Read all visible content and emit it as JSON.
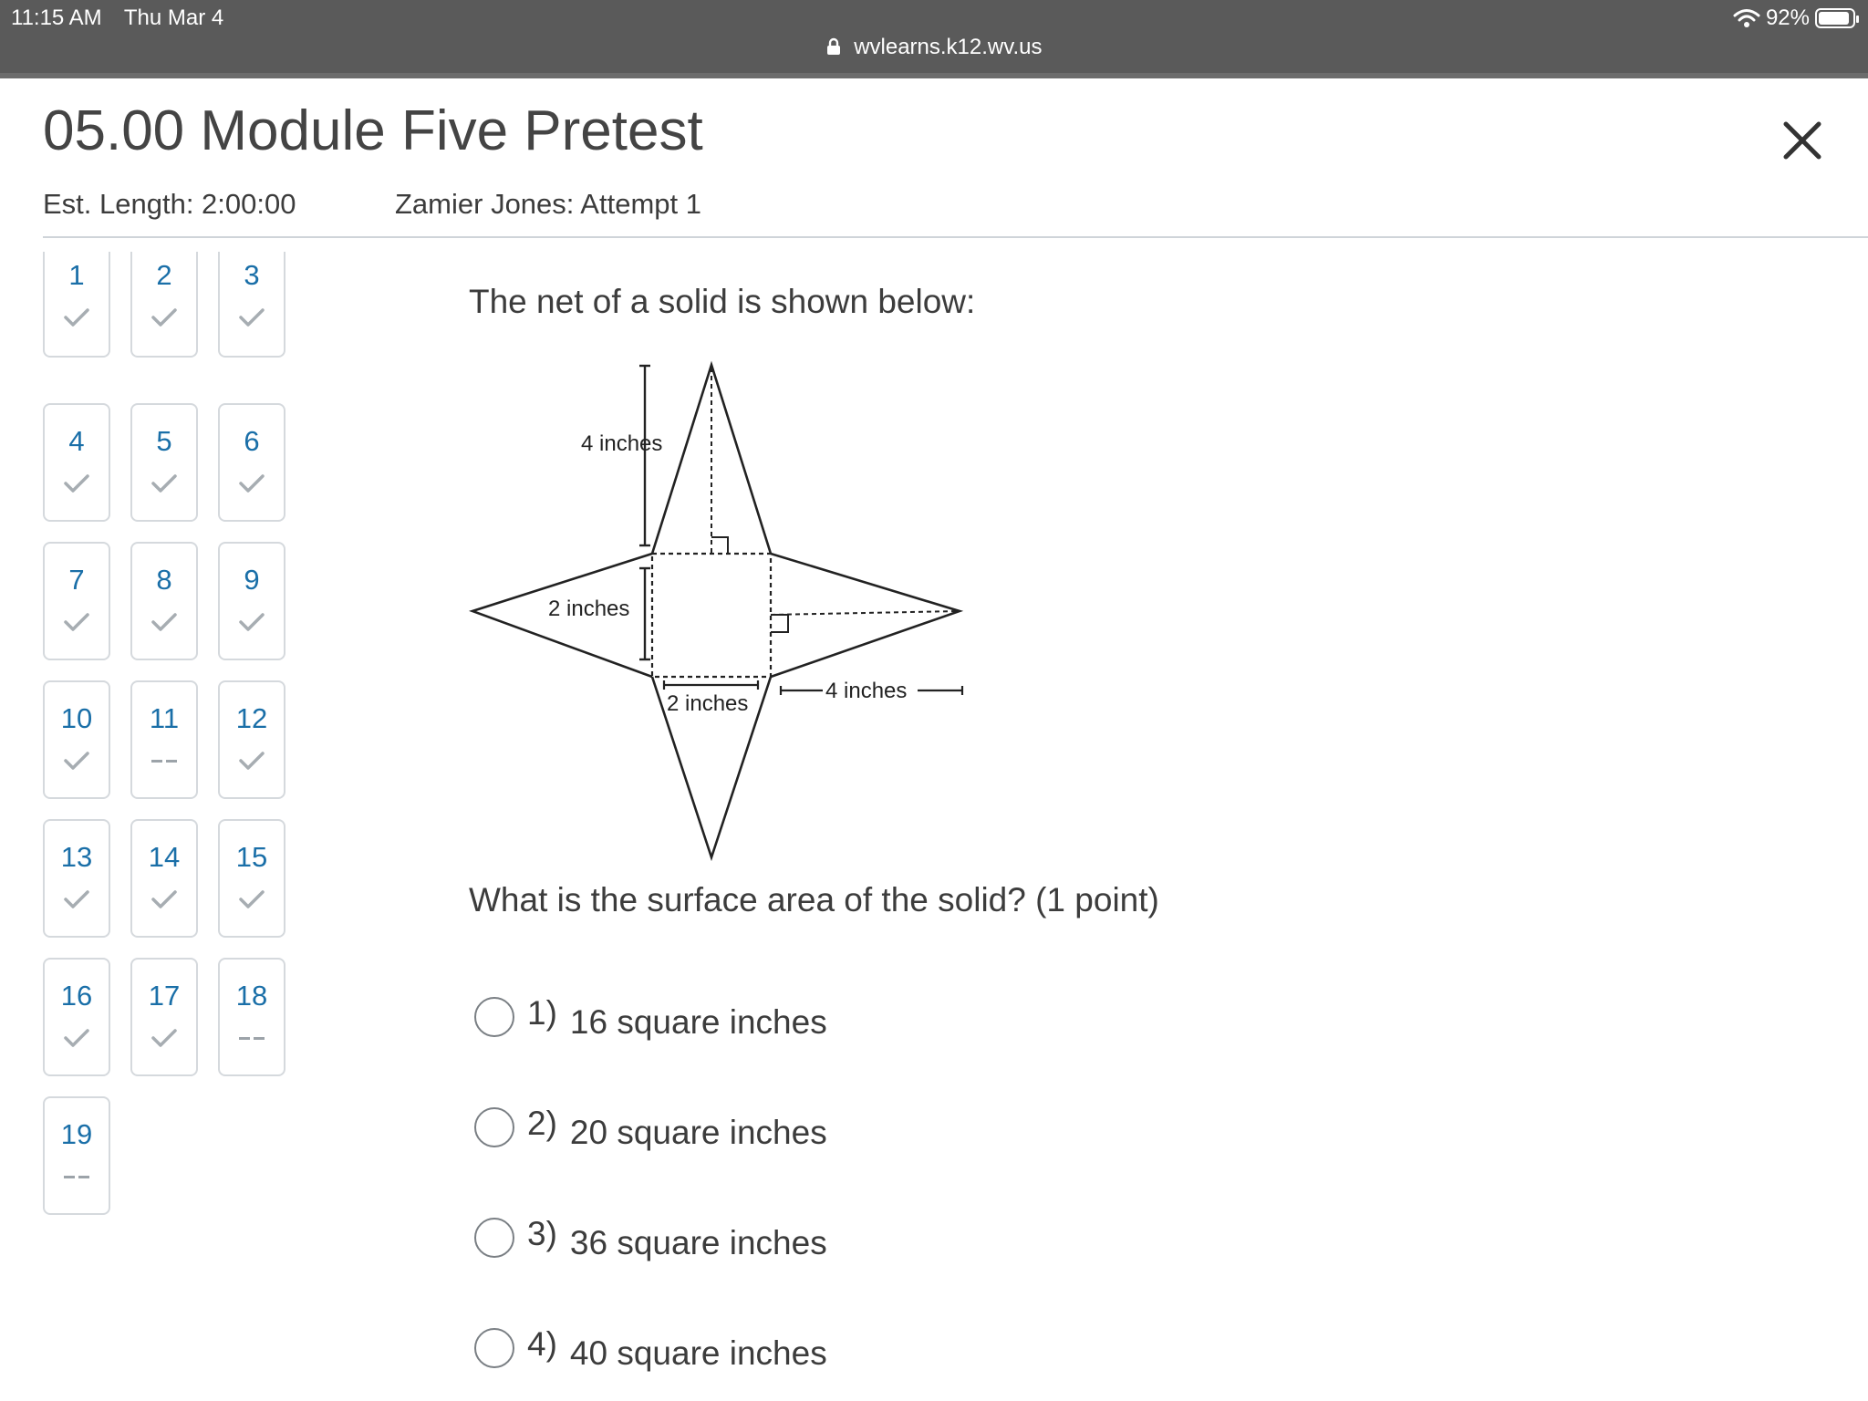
{
  "status": {
    "time": "11:15 AM",
    "date": "Thu Mar 4",
    "battery": "92%",
    "battery_level": 0.92
  },
  "browser": {
    "url": "wvlearns.k12.wv.us"
  },
  "header": {
    "title": "05.00 Module Five Pretest",
    "est_length": "Est. Length: 2:00:00",
    "attempt": "Zamier Jones: Attempt 1"
  },
  "questions": [
    {
      "num": "1",
      "state": "answered"
    },
    {
      "num": "2",
      "state": "answered"
    },
    {
      "num": "3",
      "state": "answered"
    },
    {
      "num": "4",
      "state": "answered"
    },
    {
      "num": "5",
      "state": "answered"
    },
    {
      "num": "6",
      "state": "answered"
    },
    {
      "num": "7",
      "state": "answered"
    },
    {
      "num": "8",
      "state": "answered"
    },
    {
      "num": "9",
      "state": "answered"
    },
    {
      "num": "10",
      "state": "answered"
    },
    {
      "num": "11",
      "state": "unanswered"
    },
    {
      "num": "12",
      "state": "answered"
    },
    {
      "num": "13",
      "state": "answered"
    },
    {
      "num": "14",
      "state": "answered"
    },
    {
      "num": "15",
      "state": "answered"
    },
    {
      "num": "16",
      "state": "answered"
    },
    {
      "num": "17",
      "state": "answered"
    },
    {
      "num": "18",
      "state": "unanswered"
    },
    {
      "num": "19",
      "state": "unanswered"
    }
  ],
  "main": {
    "prompt": "The net of a solid is shown below:",
    "figure_labels": {
      "height": "4 inches",
      "side": "2 inches",
      "base": "2 inches",
      "slant": "4 inches"
    },
    "question": "What is the surface area of the solid? (1 point)",
    "options": [
      {
        "num": "1)",
        "text": "16 square inches"
      },
      {
        "num": "2)",
        "text": "20 square inches"
      },
      {
        "num": "3)",
        "text": "36 square inches"
      },
      {
        "num": "4)",
        "text": "40 square inches"
      }
    ]
  }
}
